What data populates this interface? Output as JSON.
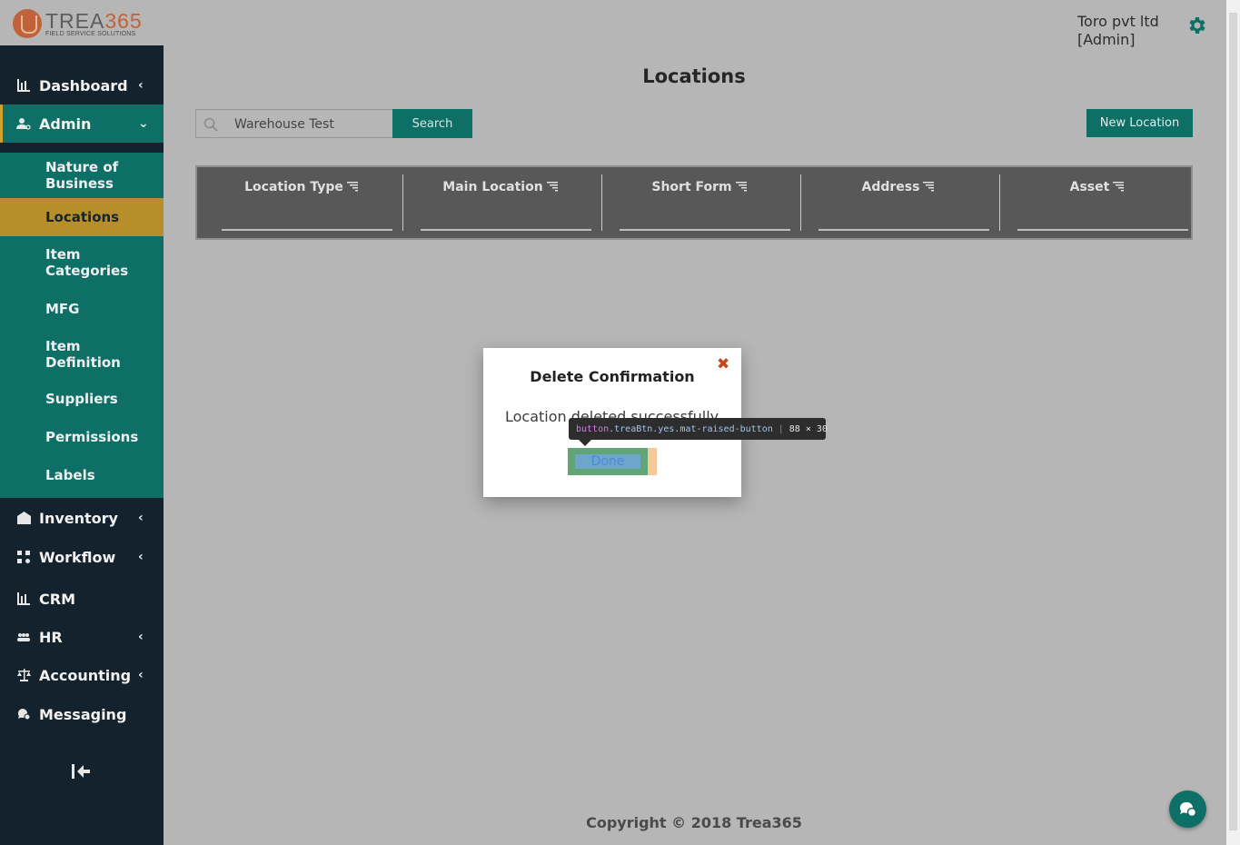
{
  "app": {
    "logo_text": "TREA365",
    "logo_subtitle": "FIELD SERVICE SOLUTIONS",
    "company": "Toro pvt ltd",
    "role": "[Admin]"
  },
  "sidebar": {
    "items": [
      {
        "label": "Dashboard",
        "icon": "bar-chart-icon"
      },
      {
        "label": "Admin",
        "icon": "admin-user-icon"
      },
      {
        "label": "Inventory",
        "icon": "warehouse-icon"
      },
      {
        "label": "Workflow",
        "icon": "workflow-icon"
      },
      {
        "label": "CRM",
        "icon": "bar-chart-icon"
      },
      {
        "label": "HR",
        "icon": "people-icon"
      },
      {
        "label": "Accounting",
        "icon": "scales-icon"
      },
      {
        "label": "Messaging",
        "icon": "chat-icon"
      }
    ],
    "admin_sub": [
      {
        "label": "Nature of Business"
      },
      {
        "label": "Locations"
      },
      {
        "label": "Item Categories"
      },
      {
        "label": "MFG"
      },
      {
        "label": "Item Definition"
      },
      {
        "label": "Suppliers"
      },
      {
        "label": "Permissions"
      },
      {
        "label": "Labels"
      }
    ]
  },
  "main": {
    "title": "Locations",
    "search": {
      "value": "Warehouse Test",
      "button": "Search"
    },
    "new_button": "New Location",
    "columns": [
      "Location Type",
      "Main Location",
      "Short Form",
      "Address",
      "Asset"
    ]
  },
  "modal": {
    "title": "Delete Confirmation",
    "message": "Location deleted successfully",
    "done": "Done"
  },
  "devtools_tooltip": {
    "tag": "button",
    "classes": ".treaBtn.yes.mat-raised-button",
    "size": "88 × 30"
  },
  "footer": {
    "copyright": "Copyright © 2018 Trea365"
  },
  "colors": {
    "teal": "#0d6f66",
    "sidebar": "#13222c",
    "active": "#b68e2a",
    "accent": "#c0623a"
  }
}
